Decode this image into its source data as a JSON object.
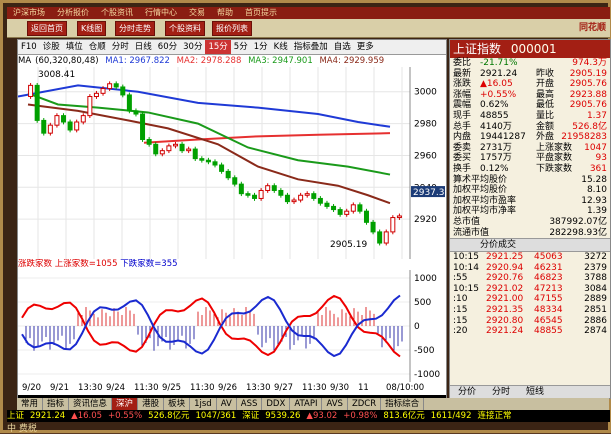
{
  "topbar": [
    "沪深市场",
    "分析报价",
    "个股资讯",
    "行情中心",
    "交易",
    "帮助",
    "首页提示"
  ],
  "toolbar": [
    "返回首页",
    "K线图",
    "分时走势",
    "个股资料",
    "报价列表"
  ],
  "app_logo": "同花顺",
  "chart_toolbar": {
    "items": [
      "F10",
      "诊股",
      "填位",
      "仓顺",
      "分时",
      "日线",
      "60分",
      "30分",
      "15分",
      "5分",
      "1分",
      "K线",
      "指标叠加",
      "自选",
      "更多"
    ],
    "selected": "15分"
  },
  "ma_bar": {
    "label": "MA",
    "params": "(60,320,80,48)",
    "ma1": "MA1: 2967.822",
    "ma2": "MA2: 2978.288",
    "ma3": "MA3: 2947.901",
    "ma4": "MA4: 2929.959"
  },
  "price_axis": [
    "3000",
    "2980",
    "2960",
    "2940",
    "2920"
  ],
  "annotations": {
    "high": "3008.41",
    "low": "2905.19",
    "cursor": "2937.35"
  },
  "indicator_bar": {
    "name": "涨跌家数",
    "up": "上涨家数=1055",
    "down": "下跌家数=355"
  },
  "ind_axis": [
    "1000",
    "500",
    "0",
    "-500",
    "-1000"
  ],
  "time_axis": [
    "9/20",
    "9/21",
    "13:30",
    "9/24",
    "11:30",
    "9/25",
    "11:30",
    "9/26",
    "13:30",
    "9/27",
    "11:30",
    "9/30",
    "11",
    "08/10:00"
  ],
  "quote": {
    "title": "上证指数",
    "code": "000001",
    "rows": [
      {
        "l": "委比",
        "v": "-21.71%",
        "l2": "",
        "v2": "974.3万"
      },
      {
        "l": "最新",
        "v": "2921.24",
        "l2": "昨收",
        "v2": "2905.19"
      },
      {
        "l": "涨跌",
        "v": "▲16.05",
        "l2": "开盘",
        "v2": "2905.76"
      },
      {
        "l": "涨幅",
        "v": "+0.55%",
        "l2": "最高",
        "v2": "2923.88"
      },
      {
        "l": "震幅",
        "v": "0.62%",
        "l2": "最低",
        "v2": "2905.76"
      },
      {
        "l": "现手",
        "v": "48855",
        "l2": "量比",
        "v2": "1.37"
      },
      {
        "l": "总手",
        "v": "4140万",
        "l2": "金额",
        "v2": "526.8亿"
      },
      {
        "l": "内盘",
        "v": "19441287",
        "l2": "外盘",
        "v2": "21958283"
      },
      {
        "l": "委卖",
        "v": "2731万",
        "l2": "上涨家数",
        "v2": "1047"
      },
      {
        "l": "委买",
        "v": "1757万",
        "l2": "平盘家数",
        "v2": "93"
      },
      {
        "l": "换手",
        "v": "0.12%",
        "l2": "下跌家数",
        "v2": "361"
      }
    ],
    "stats": [
      {
        "l": "算术平均股价",
        "v": "15.28"
      },
      {
        "l": "加权平均股价",
        "v": "8.10"
      },
      {
        "l": "加权平均市盈率",
        "v": "12.93"
      },
      {
        "l": "加权平均市净率",
        "v": "1.39"
      },
      {
        "l": "总市值",
        "v": "387992.07亿"
      },
      {
        "l": "流通市值",
        "v": "282298.93亿"
      }
    ],
    "tabs": "分价成交",
    "ticks": [
      {
        "t": "10:15",
        "p": "2921.25",
        "v": "45063",
        "n": "3272"
      },
      {
        "t": "10:14",
        "p": "2920.94",
        "v": "46231",
        "n": "2379"
      },
      {
        "t": ":55",
        "p": "2920.76",
        "v": "46823",
        "n": "3788"
      },
      {
        "t": "10:15",
        "p": "2921.02",
        "v": "47213",
        "n": "3084"
      },
      {
        "t": ":10",
        "p": "2921.00",
        "v": "47155",
        "n": "2889"
      },
      {
        "t": ":15",
        "p": "2921.35",
        "v": "48334",
        "n": "2851"
      },
      {
        "t": ":15",
        "p": "2920.80",
        "v": "46545",
        "n": "2886"
      },
      {
        "t": ":20",
        "p": "2921.24",
        "v": "48855",
        "n": "2874"
      }
    ],
    "footer": [
      "分价",
      "分时",
      "短线"
    ]
  },
  "bottom_tabs": {
    "items": [
      "常用",
      "指标",
      "资讯信息",
      "深沪",
      "港股",
      "板块",
      "1jsd",
      "AV",
      "ASS",
      "DDX",
      "ATAPI",
      "AVS",
      "ZDCR",
      "指标综合"
    ],
    "selected": "深沪"
  },
  "status": [
    "上证",
    "2921.24",
    "▲16.05",
    "+0.55%",
    "526.8亿元",
    "1047/361",
    "深证",
    "9539.26",
    "▲93.02",
    "+0.98%",
    "813.6亿元",
    "1611/492",
    "连接正常"
  ],
  "corner": "中 费税",
  "colors": {
    "up": "#d00000",
    "down": "#00a000",
    "ma1": "#1f3ad6",
    "ma2": "#e63030",
    "ma3": "#1a9a1a",
    "ma4": "#8a2a1a"
  }
}
